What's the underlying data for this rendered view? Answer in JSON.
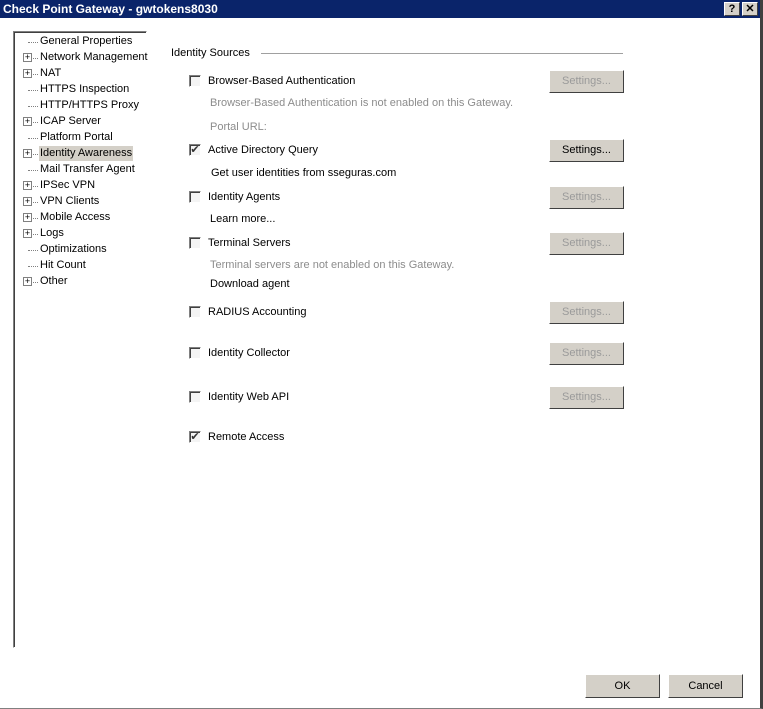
{
  "window": {
    "title": "Check Point Gateway - gwtokens8030",
    "help_label": "?",
    "close_label": "✕"
  },
  "tree": [
    {
      "label": "General Properties",
      "expandable": false
    },
    {
      "label": "Network Management",
      "expandable": true
    },
    {
      "label": "NAT",
      "expandable": true
    },
    {
      "label": "HTTPS Inspection",
      "expandable": false
    },
    {
      "label": "HTTP/HTTPS Proxy",
      "expandable": false
    },
    {
      "label": "ICAP Server",
      "expandable": true
    },
    {
      "label": "Platform Portal",
      "expandable": false
    },
    {
      "label": "Identity Awareness",
      "expandable": true,
      "selected": true
    },
    {
      "label": "Mail Transfer Agent",
      "expandable": false
    },
    {
      "label": "IPSec VPN",
      "expandable": true
    },
    {
      "label": "VPN Clients",
      "expandable": true
    },
    {
      "label": "Mobile Access",
      "expandable": true
    },
    {
      "label": "Logs",
      "expandable": true
    },
    {
      "label": "Optimizations",
      "expandable": false
    },
    {
      "label": "Hit Count",
      "expandable": false
    },
    {
      "label": "Other",
      "expandable": true
    }
  ],
  "identity_sources": {
    "title": "Identity Sources",
    "settings_label": "Settings...",
    "browser_auth": {
      "label": "Browser-Based Authentication",
      "checked": false,
      "note": "Browser-Based Authentication is not enabled on this Gateway.",
      "portal": "Portal URL:"
    },
    "ad_query": {
      "label": "Active Directory Query",
      "checked": true,
      "note": "Get user identities from sseguras.com"
    },
    "identity_agents": {
      "label": "Identity Agents",
      "checked": false,
      "link": "Learn more..."
    },
    "terminal_servers": {
      "label": "Terminal Servers",
      "checked": false,
      "note": "Terminal servers are not enabled on this Gateway.",
      "link": "Download agent"
    },
    "radius": {
      "label": "RADIUS Accounting",
      "checked": false
    },
    "collector": {
      "label": "Identity Collector",
      "checked": false
    },
    "web_api": {
      "label": "Identity Web API",
      "checked": false
    },
    "remote_access": {
      "label": "Remote Access",
      "checked": true
    }
  },
  "footer": {
    "ok": "OK",
    "cancel": "Cancel"
  }
}
